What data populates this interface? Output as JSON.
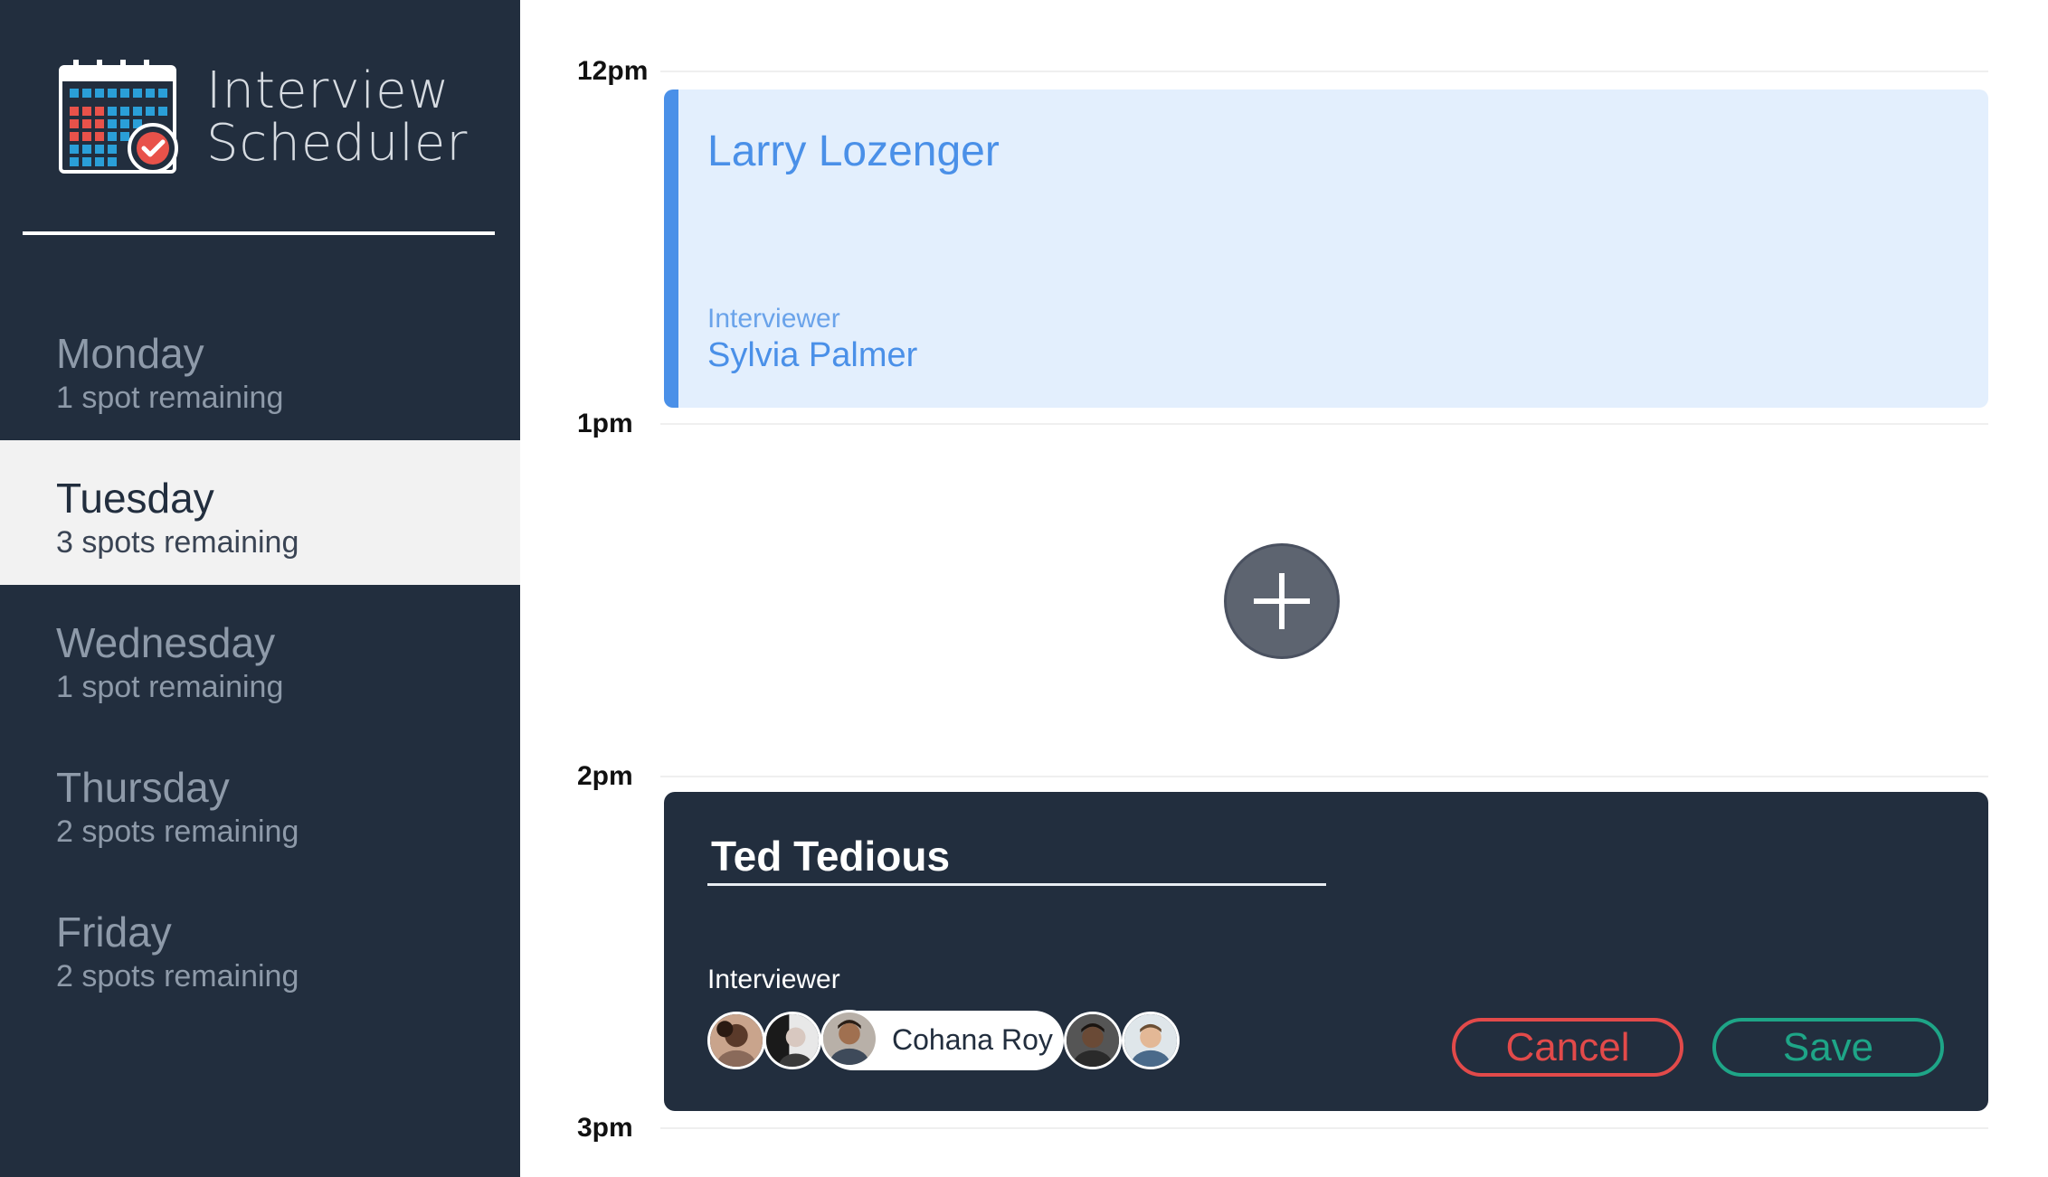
{
  "app": {
    "title_line1": "Interview",
    "title_line2": "Scheduler"
  },
  "sidebar": {
    "days": [
      {
        "name": "Monday",
        "spots": "1 spot remaining",
        "active": false
      },
      {
        "name": "Tuesday",
        "spots": "3 spots remaining",
        "active": true
      },
      {
        "name": "Wednesday",
        "spots": "1 spot remaining",
        "active": false
      },
      {
        "name": "Thursday",
        "spots": "2 spots remaining",
        "active": false
      },
      {
        "name": "Friday",
        "spots": "2 spots remaining",
        "active": false
      }
    ]
  },
  "schedule": {
    "times": [
      "12pm",
      "1pm",
      "2pm",
      "3pm"
    ],
    "booked": {
      "student": "Larry Lozenger",
      "interviewer_label": "Interviewer",
      "interviewer": "Sylvia Palmer"
    },
    "add_icon": "plus-icon",
    "edit": {
      "student_value": "Ted Tedious",
      "interviewer_label": "Interviewer",
      "selected_interviewer": "Cohana Roy",
      "avatar_count": 5,
      "selected_index": 2,
      "cancel_label": "Cancel",
      "save_label": "Save"
    }
  },
  "colors": {
    "sidebar_bg": "#222e3e",
    "booked_bg": "#e3effd",
    "booked_accent": "#4a90e8",
    "cancel": "#e24a4a",
    "save": "#1ea587"
  }
}
